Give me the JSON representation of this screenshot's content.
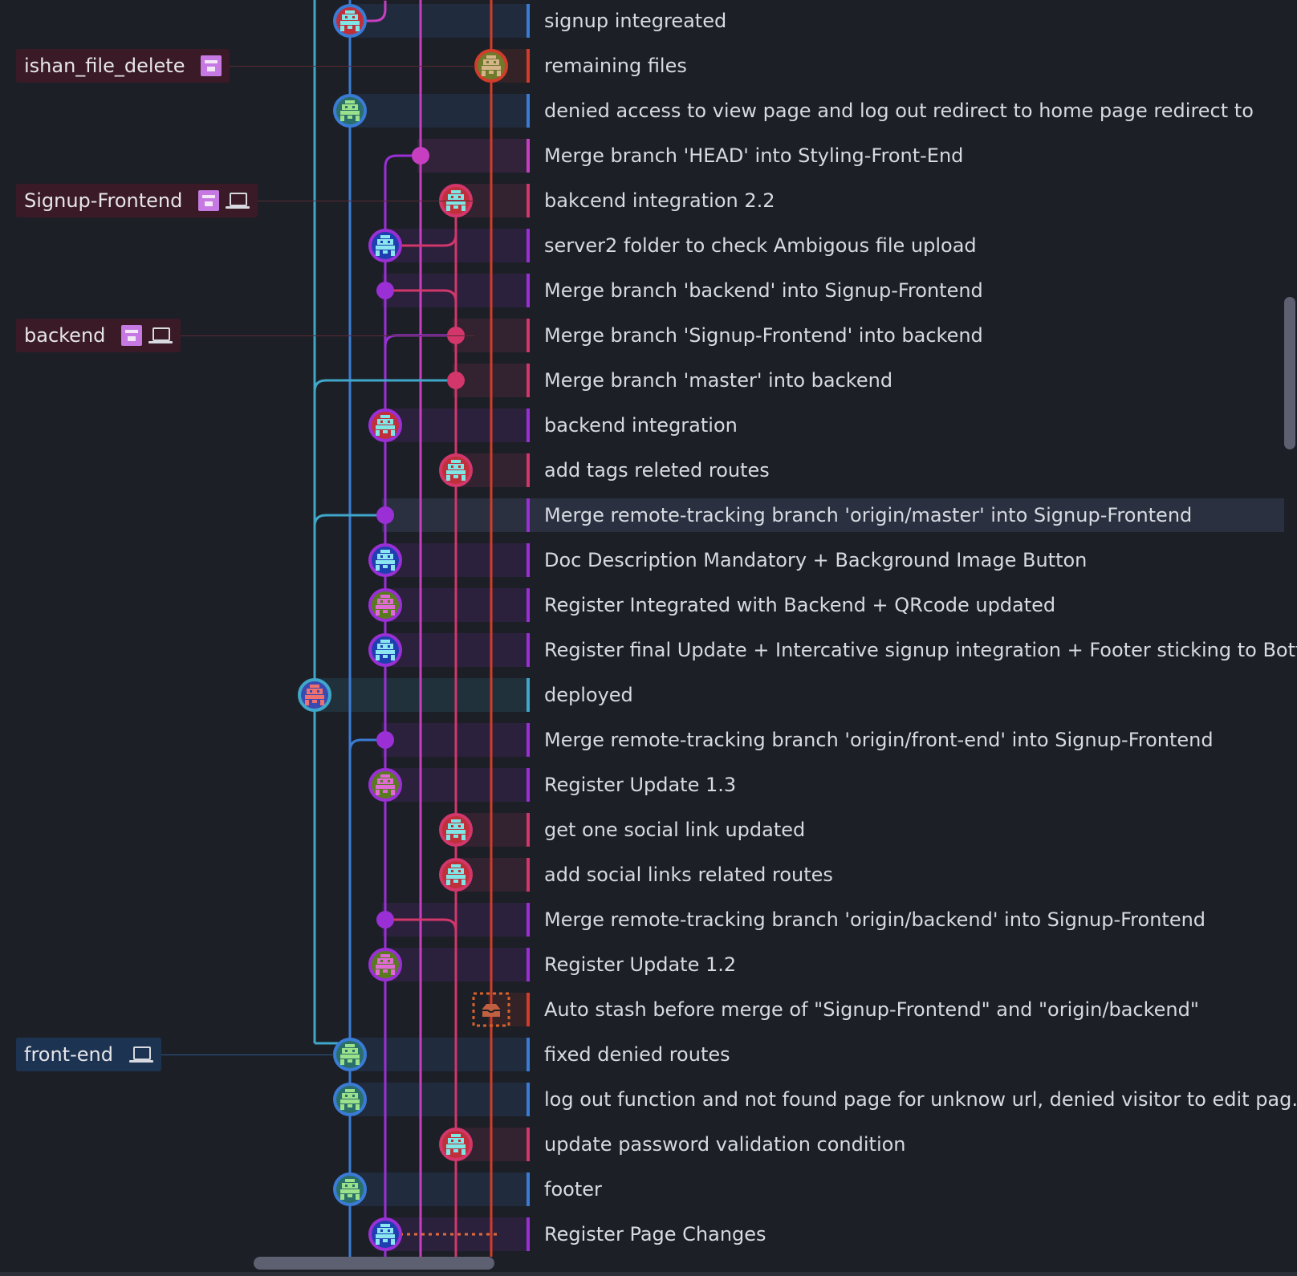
{
  "branches": [
    {
      "label": "ishan_file_delete",
      "row": 1,
      "icons": [
        "avatar-icon"
      ],
      "color": "#e0503c"
    },
    {
      "label": "Signup-Frontend",
      "row": 4,
      "icons": [
        "avatar-icon",
        "laptop-icon"
      ],
      "color": "#d2366a"
    },
    {
      "label": "backend",
      "row": 7,
      "icons": [
        "avatar-icon",
        "laptop-icon"
      ],
      "color": "#d2366a"
    },
    {
      "label": "front-end",
      "row": 23,
      "icons": [
        "laptop-icon"
      ],
      "color": "#3a7bd5"
    }
  ],
  "commits": [
    {
      "message": "signup integreated",
      "lane": "blue",
      "type": "avatar",
      "avatar": "cyan-robot"
    },
    {
      "message": "remaining files",
      "lane": "red",
      "type": "avatar",
      "avatar": "olive-robot"
    },
    {
      "message": "denied access to view page and log out redirect to home page redirect to",
      "lane": "blue",
      "type": "avatar",
      "avatar": "green-robot"
    },
    {
      "message": "Merge branch 'HEAD' into Styling-Front-End",
      "lane": "magenta",
      "type": "merge"
    },
    {
      "message": "bakcend integration 2.2",
      "lane": "pink",
      "type": "avatar",
      "avatar": "cyan-robot"
    },
    {
      "message": "server2 folder to check Ambigous file upload",
      "lane": "purple",
      "type": "avatar",
      "avatar": "blue-robot"
    },
    {
      "message": "Merge branch 'backend' into Signup-Frontend",
      "lane": "purple",
      "type": "merge"
    },
    {
      "message": "Merge branch 'Signup-Frontend' into backend",
      "lane": "pink",
      "type": "merge"
    },
    {
      "message": "Merge branch 'master' into backend",
      "lane": "pink",
      "type": "merge"
    },
    {
      "message": "backend integration",
      "lane": "purple",
      "type": "avatar",
      "avatar": "cyan-robot"
    },
    {
      "message": "add tags releted routes",
      "lane": "pink",
      "type": "avatar",
      "avatar": "cyan-robot"
    },
    {
      "message": "Merge remote-tracking branch 'origin/master' into Signup-Frontend",
      "lane": "purple",
      "type": "merge",
      "selected": true
    },
    {
      "message": "Doc Description Mandatory + Background Image Button",
      "lane": "purple",
      "type": "avatar",
      "avatar": "blue-robot"
    },
    {
      "message": "Register Integrated with Backend + QRcode updated",
      "lane": "purple",
      "type": "avatar",
      "avatar": "pink-robot"
    },
    {
      "message": "Register final Update + Intercative signup integration + Footer sticking to Bott...",
      "lane": "purple",
      "type": "avatar",
      "avatar": "blue-robot"
    },
    {
      "message": "deployed",
      "lane": "teal",
      "type": "avatar",
      "avatar": "red-robot"
    },
    {
      "message": "Merge remote-tracking branch 'origin/front-end' into Signup-Frontend",
      "lane": "purple",
      "type": "merge"
    },
    {
      "message": "Register Update 1.3",
      "lane": "purple",
      "type": "avatar",
      "avatar": "pink-robot"
    },
    {
      "message": "get one social link updated",
      "lane": "pink",
      "type": "avatar",
      "avatar": "cyan-robot"
    },
    {
      "message": "add social links related routes",
      "lane": "pink",
      "type": "avatar",
      "avatar": "cyan-robot"
    },
    {
      "message": "Merge remote-tracking branch 'origin/backend' into Signup-Frontend",
      "lane": "purple",
      "type": "merge"
    },
    {
      "message": "Register Update 1.2",
      "lane": "purple",
      "type": "avatar",
      "avatar": "pink-robot"
    },
    {
      "message": "Auto stash before merge of \"Signup-Frontend\" and \"origin/backend\"",
      "lane": "red",
      "type": "stash"
    },
    {
      "message": "fixed denied routes",
      "lane": "blue",
      "type": "avatar",
      "avatar": "green-robot"
    },
    {
      "message": "log out function and not found page for unknow url, denied visitor to edit pag...",
      "lane": "blue",
      "type": "avatar",
      "avatar": "green-robot"
    },
    {
      "message": "update password validation condition",
      "lane": "pink",
      "type": "avatar",
      "avatar": "cyan-robot"
    },
    {
      "message": "footer",
      "lane": "blue",
      "type": "avatar",
      "avatar": "green-robot"
    },
    {
      "message": "Register Page Changes",
      "lane": "purple",
      "type": "avatar",
      "avatar": "blue-robot"
    }
  ],
  "lane_colors": {
    "teal": "#3fa7c9",
    "blue": "#3a7bd5",
    "purple": "#9b2fd6",
    "magenta": "#c73fc0",
    "pink": "#d2366a",
    "red": "#d23c2a"
  }
}
